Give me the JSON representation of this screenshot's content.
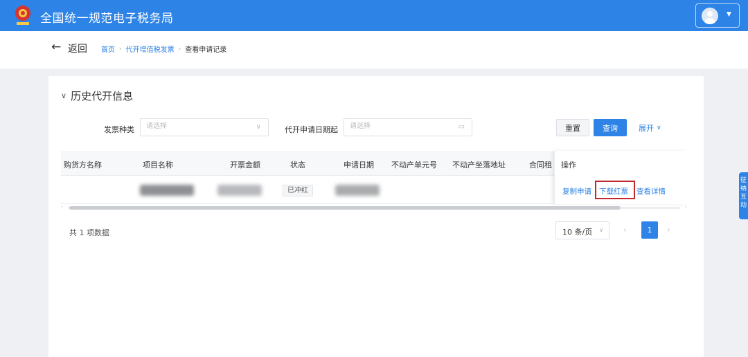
{
  "header": {
    "app_title": "全国统一规范电子税务局",
    "accent_color": "#2d83e6"
  },
  "breadcrumb": {
    "back_label": "返回",
    "items": [
      "首页",
      "代开增值税发票",
      "查看申请记录"
    ]
  },
  "section": {
    "title": "历史代开信息"
  },
  "filters": {
    "invoice_type_label": "发票种类",
    "invoice_type_placeholder": "请选择",
    "date_label": "代开申请日期起",
    "date_placeholder": "请选择",
    "reset_label": "重置",
    "query_label": "查询",
    "expand_label": "展开"
  },
  "table": {
    "columns": [
      "购货方名称",
      "项目名称",
      "开票金额",
      "状态",
      "申请日期",
      "不动产单元号",
      "不动产坐落地址",
      "合同租",
      "操作"
    ],
    "rows": [
      {
        "status": "已冲红",
        "actions": [
          "复制申请",
          "下载红票",
          "查看详情"
        ]
      }
    ],
    "highlighted_action": "下载红票"
  },
  "pagination": {
    "total_text": "共 1 项数据",
    "page_size": "10 条/页",
    "current_page": "1"
  },
  "side_tab": {
    "label": "征纳互动"
  }
}
